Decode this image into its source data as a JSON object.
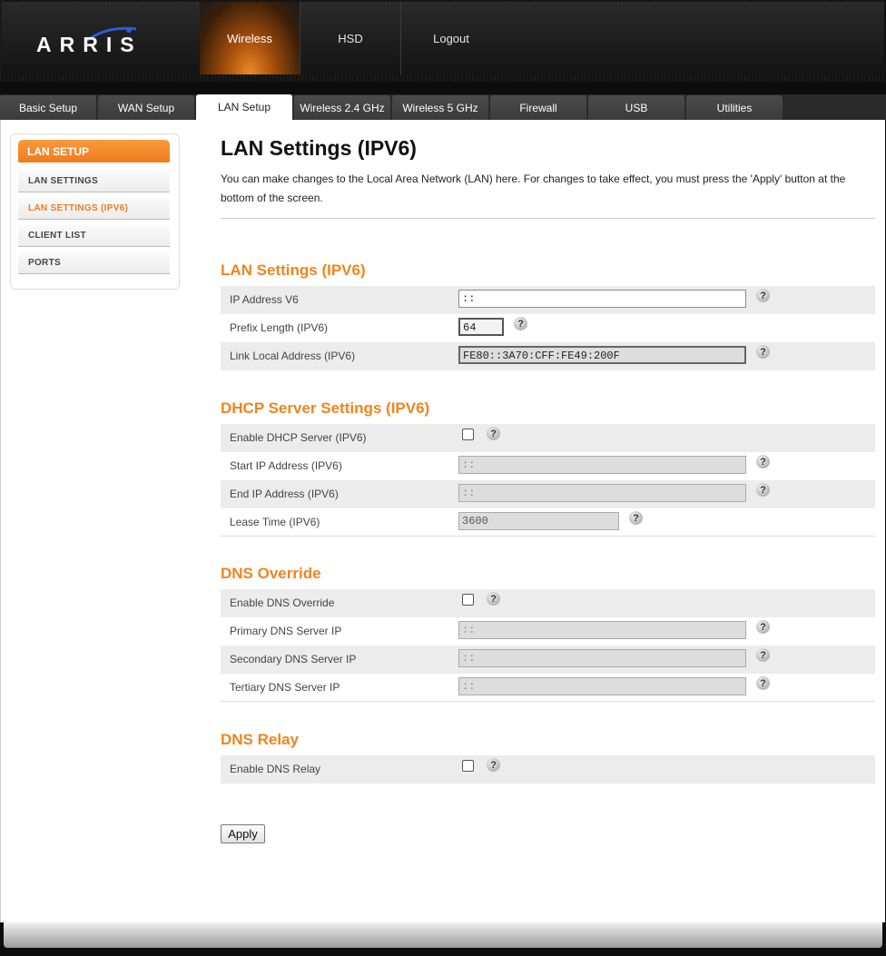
{
  "brand": {
    "logo_text": "ARRIS"
  },
  "top_nav": [
    {
      "label": "Wireless",
      "active": true
    },
    {
      "label": "HSD",
      "active": false
    },
    {
      "label": "Logout",
      "active": false
    }
  ],
  "tabs": [
    {
      "label": "Basic Setup"
    },
    {
      "label": "WAN Setup"
    },
    {
      "label": "LAN Setup",
      "active": true
    },
    {
      "label": "Wireless 2.4 GHz"
    },
    {
      "label": "Wireless 5 GHz"
    },
    {
      "label": "Firewall"
    },
    {
      "label": "USB"
    },
    {
      "label": "Utilities"
    }
  ],
  "sidebar": {
    "title": "LAN SETUP",
    "items": [
      {
        "label": "LAN SETTINGS"
      },
      {
        "label": "LAN SETTINGS (IPV6)",
        "active": true
      },
      {
        "label": "CLIENT LIST"
      },
      {
        "label": "PORTS"
      }
    ]
  },
  "main": {
    "title": "LAN Settings (IPV6)",
    "intro": "You can make changes to the Local Area Network (LAN) here. For changes to take effect, you must press the 'Apply' button at the bottom of the screen.",
    "sections": {
      "lan": {
        "title": "LAN Settings (IPV6)",
        "ip_label": "IP Address V6",
        "ip_value": "::",
        "prefix_label": "Prefix Length (IPV6)",
        "prefix_value": "64",
        "link_local_label": "Link Local Address (IPV6)",
        "link_local_value": "FE80::3A70:CFF:FE49:200F"
      },
      "dhcp": {
        "title": "DHCP Server Settings (IPV6)",
        "enable_label": "Enable DHCP Server (IPV6)",
        "enabled": false,
        "start_label": "Start IP Address (IPV6)",
        "start_value": "::",
        "end_label": "End IP Address (IPV6)",
        "end_value": "::",
        "lease_label": "Lease Time (IPV6)",
        "lease_value": "3600"
      },
      "dns_override": {
        "title": "DNS Override",
        "enable_label": "Enable DNS Override",
        "enabled": false,
        "primary_label": "Primary DNS Server IP",
        "primary_value": "::",
        "secondary_label": "Secondary DNS Server IP",
        "secondary_value": "::",
        "tertiary_label": "Tertiary DNS Server IP",
        "tertiary_value": "::"
      },
      "dns_relay": {
        "title": "DNS Relay",
        "enable_label": "Enable DNS Relay",
        "enabled": false
      }
    },
    "help_glyph": "?",
    "apply_label": "Apply"
  },
  "colors": {
    "accent": "#f0841d",
    "nav_active": "#f08a24"
  }
}
